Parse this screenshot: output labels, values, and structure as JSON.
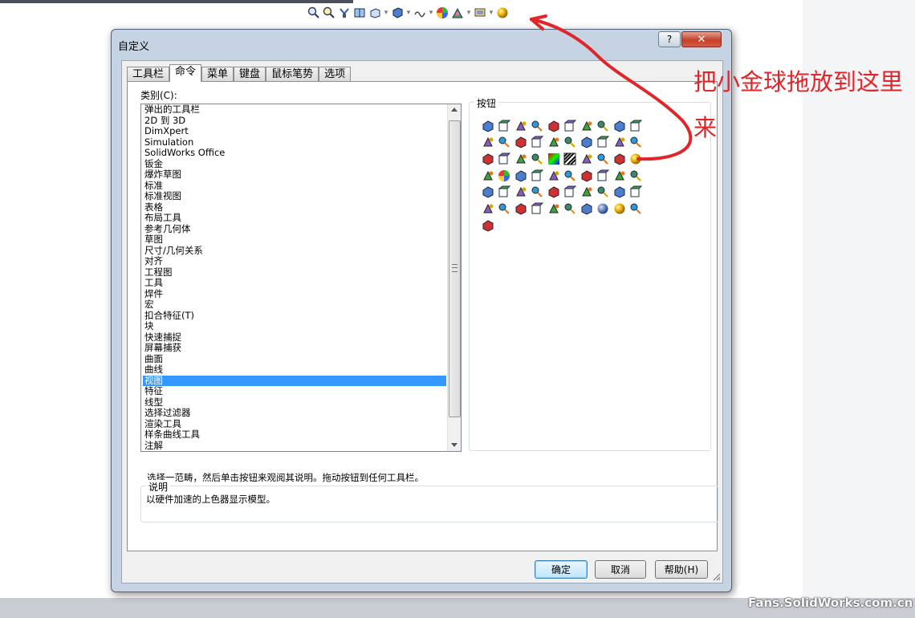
{
  "dialog": {
    "title": "自定义",
    "help_glyph": "?",
    "close_glyph": "✕",
    "tabs": [
      "工具栏",
      "命令",
      "菜单",
      "键盘",
      "鼠标笔势",
      "选项"
    ],
    "active_tab": "命令"
  },
  "categories": {
    "label": "类别(C):",
    "items": [
      "弹出的工具栏",
      "2D 到 3D",
      "DimXpert",
      "Simulation",
      "SolidWorks Office",
      "钣金",
      "爆炸草图",
      "标准",
      "标准视图",
      "表格",
      "布局工具",
      "参考几何体",
      "草图",
      "尺寸/几何关系",
      "对齐",
      "工程图",
      "工具",
      "焊件",
      "宏",
      "扣合特征(T)",
      "块",
      "快速捕捉",
      "屏幕捕获",
      "曲面",
      "曲线",
      "视图",
      "特征",
      "线型",
      "选择过滤器",
      "渲染工具",
      "样条曲线工具",
      "注解"
    ],
    "selected": "视图"
  },
  "buttons_group": {
    "label": "按钮",
    "colors": [
      "#4a7fd0",
      "#3da33d",
      "#d9a400",
      "#2a9bd6",
      "#d03030",
      "#8a5cc0",
      "#e07a1a",
      "#3a8a6a"
    ]
  },
  "instruction": "选择一范畴，然后单击按钮来观阅其说明。拖动按钮到任何工具栏。",
  "description": {
    "label": "说明",
    "text": "以硬件加速的上色器显示模型。"
  },
  "footer_buttons": {
    "ok": "确定",
    "cancel": "取消",
    "help": "帮助(H)"
  },
  "annotation": {
    "text": "把小金球拖放到这里来",
    "color": "#e0262a"
  },
  "watermark": {
    "text": "Fans.SolidWorks.com.cn"
  }
}
